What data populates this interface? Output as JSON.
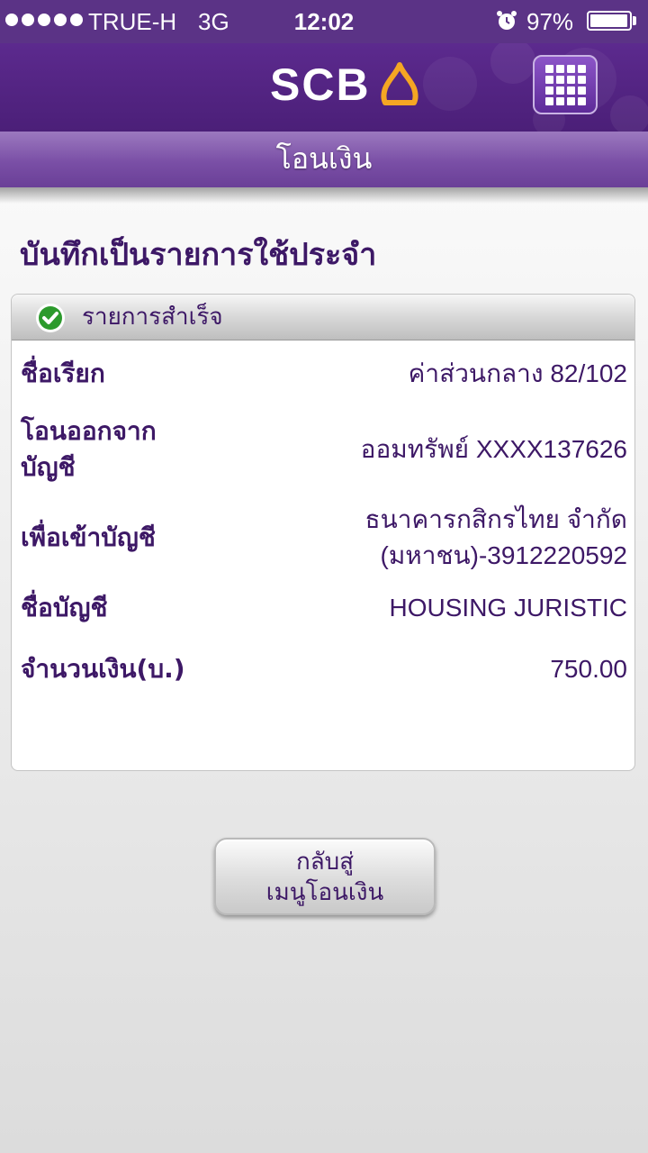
{
  "status_bar": {
    "carrier": "TRUE-H",
    "network": "3G",
    "time": "12:02",
    "battery_percent": "97%",
    "battery_level": 0.97,
    "signal_dots": 5
  },
  "header": {
    "logo_text": "SCB",
    "brand_color": "#5c2a8e",
    "accent_color": "#f5a623",
    "menu_icon": "grid-icon"
  },
  "title_bar": {
    "title": "โอนเงิน"
  },
  "page": {
    "heading": "บันทึกเป็นรายการใช้ประจำ",
    "status_icon": "check-circle-icon",
    "status_text": "รายการสำเร็จ",
    "details": [
      {
        "label_lines": [
          "ชื่อเรียก"
        ],
        "value_lines": [
          "ค่าส่วนกลาง 82/102"
        ]
      },
      {
        "label_lines": [
          "โอนออกจาก",
          "บัญชี"
        ],
        "value_lines": [
          "ออมทรัพย์ XXXX137626"
        ]
      },
      {
        "label_lines": [
          "เพื่อเข้าบัญชี"
        ],
        "value_lines": [
          "ธนาคารกสิกรไทย จำกัด",
          "(มหาชน)-3912220592"
        ]
      },
      {
        "label_lines": [
          "ชื่อบัญชี"
        ],
        "value_lines": [
          "HOUSING JURISTIC"
        ]
      },
      {
        "label_lines": [
          "จำนวนเงิน(บ.)"
        ],
        "value_lines": [
          "750.00"
        ]
      }
    ],
    "back_button": {
      "lines": [
        "กลับสู่",
        "เมนูโอนเงิน"
      ]
    }
  }
}
